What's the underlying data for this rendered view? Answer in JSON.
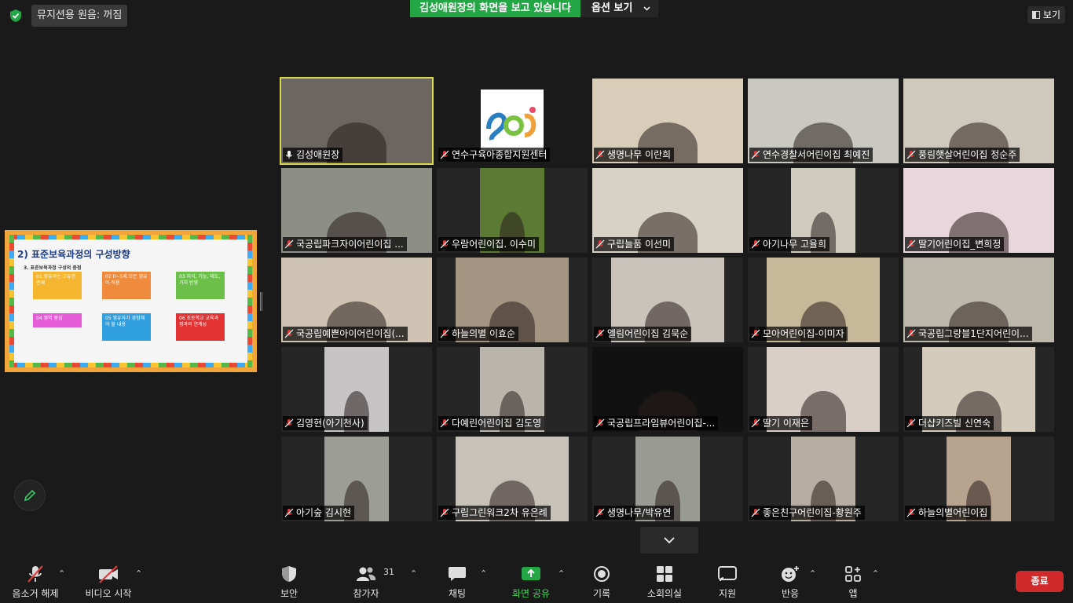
{
  "top": {
    "original_sound": "뮤지션용 원음: 꺼짐",
    "share_banner": "김성애원장의 화면을 보고 있습니다",
    "view_options": "옵션 보기",
    "view": "보기"
  },
  "slide": {
    "title": "2) 표준보육과정의 구성방향",
    "subtitle": "3. 표준보육과정 구성의 중점",
    "boxes": [
      {
        "text": "01 영유아는 고유한 존재",
        "color": "#f6b52e"
      },
      {
        "text": "02 0~5세 모든 영유아 적용",
        "color": "#f08a3c"
      },
      {
        "text": "03 지식, 기능, 태도, 가치 반영",
        "color": "#6cc04a"
      },
      {
        "text": "04 영역 중심",
        "color": "#e55bd8"
      },
      {
        "text": "05 영유아가 경험해야 할 내용",
        "color": "#2f9fe0"
      },
      {
        "text": "06 초등학교 교육과정과의 연계성",
        "color": "#e23232"
      }
    ]
  },
  "participants": [
    {
      "name": "김성애원장",
      "bg": "#6b6660",
      "w": 192
    },
    {
      "name": "연수구육아종합지원센터",
      "bg": "#1b1b1b",
      "w": 192
    },
    {
      "name": "생명나무 이란희",
      "bg": "#d8cdb8",
      "w": 192
    },
    {
      "name": "연수경찰서어린이집 최예진",
      "bg": "#c9c9c2",
      "w": 192
    },
    {
      "name": "풍림햇살어린이집 정순주",
      "bg": "#cfc8bd",
      "w": 192
    },
    {
      "name": "국공립파크자이어린이집 ...",
      "bg": "#8d8f86",
      "w": 192
    },
    {
      "name": "우람어린이집. 이수미",
      "bg": "#5c7a34",
      "w": 82
    },
    {
      "name": "구립늘품 이선미",
      "bg": "#d8d2c6",
      "w": 192
    },
    {
      "name": "아기나무 고율희",
      "bg": "#cfcbbf",
      "w": 82
    },
    {
      "name": "딸기어린이집_변희정",
      "bg": "#e8d6dc",
      "w": 192
    },
    {
      "name": "국공립예쁜아이어린이집(...",
      "bg": "#cfc3b4",
      "w": 192
    },
    {
      "name": "하늘의별 이효순",
      "bg": "#a49583",
      "w": 144
    },
    {
      "name": "엘림어린이집 김묵순",
      "bg": "#c9c3bb",
      "w": 144
    },
    {
      "name": "모아어린이집-이미자",
      "bg": "#c8b89a",
      "w": 144
    },
    {
      "name": "국공립그랑블1단지어린이...",
      "bg": "#bdb8ac",
      "w": 192
    },
    {
      "name": "김영현(아기천사)",
      "bg": "#c6c4c5",
      "w": 82
    },
    {
      "name": "다예린어린이집 김도영",
      "bg": "#b9b5ad",
      "w": 82
    },
    {
      "name": "국공립프라임뷰어린이집-...",
      "bg": "#111111",
      "w": 192
    },
    {
      "name": "딸기 이재은",
      "bg": "#d9cfc8",
      "w": 144
    },
    {
      "name": "더샵키즈빌 신연숙",
      "bg": "#d5cbbd",
      "w": 144
    },
    {
      "name": "아기숲 김시현",
      "bg": "#9d9d98",
      "w": 82
    },
    {
      "name": "구립그린워크2차 유은례",
      "bg": "#c7c2b9",
      "w": 144
    },
    {
      "name": "생명나무/박유연",
      "bg": "#9a9a94",
      "w": 82
    },
    {
      "name": "좋은친구어린이집-황원주",
      "bg": "#b7aea3",
      "w": 82
    },
    {
      "name": "하늘의별어린이집",
      "bg": "#b8a38f",
      "w": 82
    }
  ],
  "toolbar": {
    "unmute": "음소거 해제",
    "start_video": "비디오 시작",
    "security": "보안",
    "participants": "참가자",
    "participant_count": "31",
    "chat": "채팅",
    "share_screen": "화면 공유",
    "record": "기록",
    "breakout": "소회의실",
    "support": "지원",
    "reactions": "반응",
    "apps": "앱",
    "end": "종료"
  },
  "colors": {
    "share_green": "#23a744",
    "end_red": "#d12a2a",
    "active_speaker": "#d8d84a"
  }
}
